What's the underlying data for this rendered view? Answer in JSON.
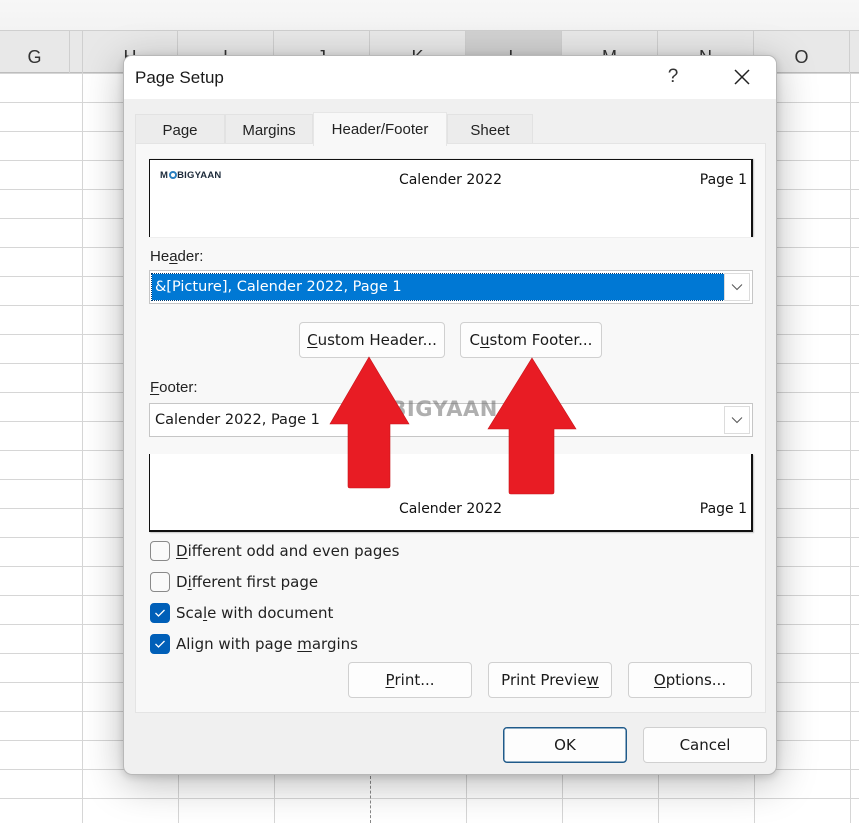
{
  "spreadsheet": {
    "columns": [
      {
        "label": "G"
      },
      {
        "label": "H"
      },
      {
        "label": "I"
      },
      {
        "label": "J"
      },
      {
        "label": "K"
      },
      {
        "label": "L"
      },
      {
        "label": "M"
      },
      {
        "label": "N"
      },
      {
        "label": "O"
      }
    ]
  },
  "dialog": {
    "title": "Page Setup",
    "help_label": "?",
    "tabs": [
      {
        "label": "Page",
        "active": false
      },
      {
        "label": "Margins",
        "active": false
      },
      {
        "label": "Header/Footer",
        "active": true
      },
      {
        "label": "Sheet",
        "active": false
      }
    ],
    "header_preview": {
      "left": "MOBIGYAAN",
      "center": "Calender 2022",
      "right": "Page 1"
    },
    "header_label": "Header:",
    "header_label_parts": {
      "pre": "He",
      "accel": "a",
      "post": "der:"
    },
    "header_value": "&[Picture], Calender 2022, Page 1",
    "custom_header_button": {
      "accel": "C",
      "rest": "ustom Header..."
    },
    "custom_footer_button": {
      "pre": "C",
      "accel": "u",
      "rest": "stom Footer..."
    },
    "footer_label_parts": {
      "accel": "F",
      "post": "ooter:"
    },
    "footer_value": "Calender 2022, Page 1",
    "footer_preview": {
      "left": "",
      "center": "Calender 2022",
      "right": "Page 1"
    },
    "options": [
      {
        "pre": "",
        "accel": "D",
        "post": "ifferent odd and even pages",
        "checked": false
      },
      {
        "pre": "D",
        "accel": "i",
        "post": "fferent first page",
        "checked": false
      },
      {
        "pre": "Sca",
        "accel": "l",
        "post": "e with document",
        "checked": true
      },
      {
        "pre": "Align with page ",
        "accel": "m",
        "post": "argins",
        "checked": true
      }
    ],
    "print_button": {
      "accel": "P",
      "rest": "rint..."
    },
    "print_preview_button": {
      "pre": "Print Previe",
      "accel": "w"
    },
    "options_button": {
      "accel": "O",
      "rest": "ptions..."
    },
    "ok_label": "OK",
    "cancel_label": "Cancel"
  },
  "annotation": {
    "watermark_pre": "M",
    "watermark_post": "BIGYAAN",
    "arrow_color": "#e81c24"
  }
}
